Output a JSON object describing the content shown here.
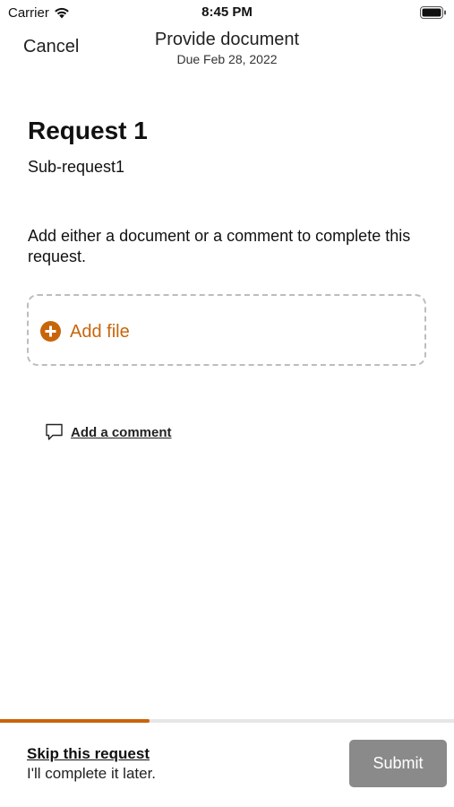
{
  "status_bar": {
    "carrier": "Carrier",
    "time": "8:45 PM"
  },
  "nav": {
    "cancel_label": "Cancel",
    "title": "Provide document",
    "subtitle": "Due Feb 28, 2022"
  },
  "request": {
    "title": "Request 1",
    "sub_request": "Sub-request1",
    "instruction": "Add either a document or a comment to complete this request."
  },
  "add_file": {
    "label": "Add file",
    "icon": "plus-circle-icon"
  },
  "comment": {
    "label": "Add a comment",
    "icon": "speech-bubble-icon"
  },
  "progress": {
    "fraction": 0.33
  },
  "footer": {
    "skip_label": "Skip this request",
    "skip_note": "I'll complete it later.",
    "submit_label": "Submit"
  },
  "colors": {
    "accent": "#c8650a",
    "submit_disabled": "#8a8a8a",
    "dashed_border": "#bdbdbd"
  }
}
